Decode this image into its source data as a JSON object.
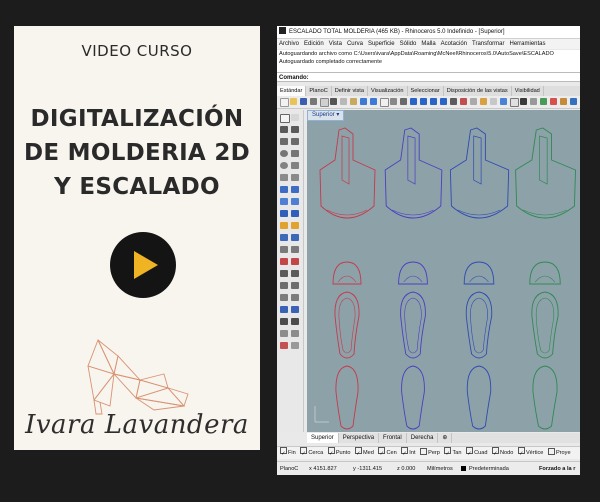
{
  "card": {
    "kicker": "VIDEO CURSO",
    "title_lines": [
      "DIGITALIZACIÓN",
      "DE MOLDERIA 2D",
      "Y ESCALADO"
    ],
    "signature": "Ivara Lavandera",
    "play_color": "#f0b323"
  },
  "rhino": {
    "title": "ESCALADO TOTAL MOLDERIA (465 KB) - Rhinoceros 5.0 Indefinido - [Superior]",
    "menu": [
      "Archivo",
      "Edición",
      "Vista",
      "Curva",
      "Superficie",
      "Sólido",
      "Malla",
      "Acotación",
      "Transformar",
      "Herramientas"
    ],
    "history": [
      "Autoguardando archivo como C:\\Users\\ivara\\AppData\\Roaming\\McNeel\\Rhinoceros\\5.0\\AutoSave\\ESCALADO",
      "Autoguardado completado correctamente"
    ],
    "command_label": "Comando:",
    "toolbar_tabs": [
      "Estándar",
      "PlanoC",
      "Definir vista",
      "Visualización",
      "Seleccionar",
      "Disposición de las vistas",
      "Visibilidad"
    ],
    "viewport_label": "Superior",
    "view_tabs": [
      "Superior",
      "Perspectiva",
      "Frontal",
      "Derecha"
    ],
    "osnaps": [
      "Fin",
      "Cerca",
      "Punto",
      "Med",
      "Cen",
      "Int",
      "Perp",
      "Tan",
      "Cuad",
      "Nodo",
      "Vértice",
      "Proye"
    ],
    "status": {
      "cplane": "PlanoC",
      "x": "x 4151.827",
      "y": "y -1311.415",
      "z": "z 0.000",
      "units": "Milímetros",
      "layer": "Predeterminada",
      "mode": "Forzado a la r"
    },
    "series_colors": [
      "#c43a4a",
      "#4b3fbf",
      "#2f4bb0",
      "#2e8a52"
    ]
  }
}
